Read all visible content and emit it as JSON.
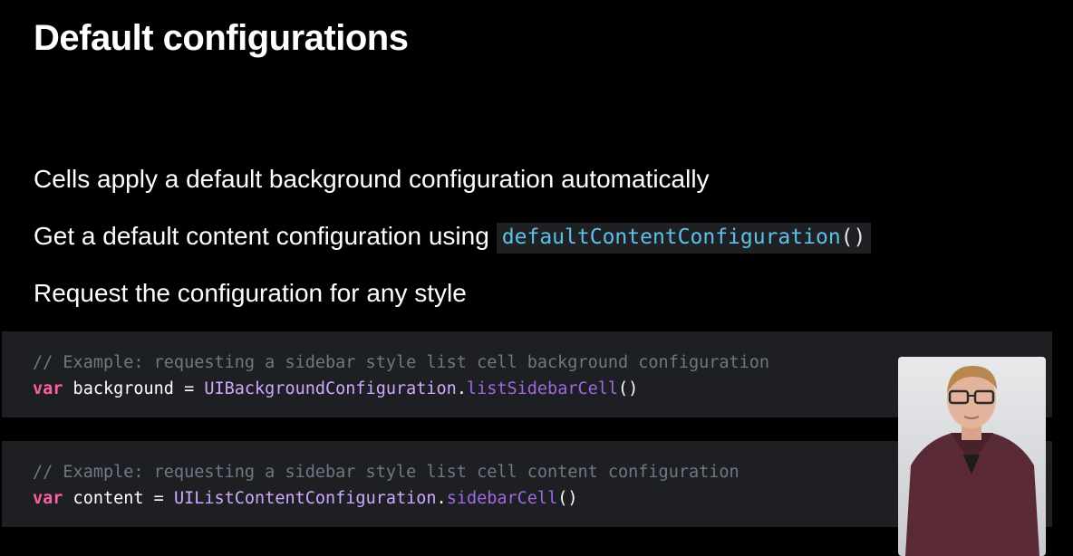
{
  "slide": {
    "title": "Default configurations",
    "bullets": {
      "b1": "Cells apply a default background configuration automatically",
      "b2_text": "Get a default content configuration using",
      "b2_code_fn": "defaultContentConfiguration",
      "b2_code_paren": "()",
      "b3": "Request the configuration for any style"
    }
  },
  "code_blocks": {
    "background": {
      "comment": "// Example: requesting a sidebar style list cell background configuration",
      "kw": "var",
      "var_part": " background = ",
      "type": "UIBackgroundConfiguration",
      "dot": ".",
      "method": "listSidebarCell",
      "parens": "()"
    },
    "content": {
      "comment": "// Example: requesting a sidebar style list cell content configuration",
      "kw": "var",
      "var_part": " content = ",
      "type": "UIListContentConfiguration",
      "dot": ".",
      "method": "sidebarCell",
      "parens": "()"
    }
  },
  "colors": {
    "background": "#000000",
    "code_bg": "#1e1f22",
    "comment": "#6c7986",
    "keyword": "#fc5fa3",
    "type": "#d0a8ff",
    "method": "#a167e6",
    "inline_fn": "#5ec0e8"
  },
  "presenter": {
    "icon": "presenter-video"
  }
}
